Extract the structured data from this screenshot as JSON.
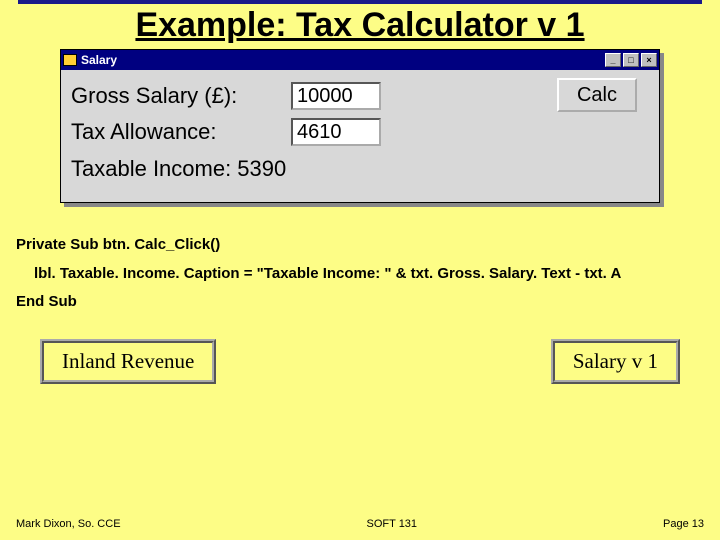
{
  "title": "Example: Tax Calculator v 1",
  "window": {
    "title": "Salary",
    "controls": {
      "min": "_",
      "max": "□",
      "close": "×"
    },
    "gross_label": "Gross Salary (£):",
    "gross_value": "10000",
    "allow_label": "Tax Allowance:",
    "allow_value": "4610",
    "result_label": "Taxable Income: 5390",
    "calc_label": "Calc"
  },
  "code": {
    "l1": "Private Sub btn. Calc_Click()",
    "l2": "lbl. Taxable. Income. Caption = \"Taxable Income: \" & txt. Gross. Salary. Text - txt. A",
    "l3": "End Sub"
  },
  "buttons": {
    "left": "Inland Revenue",
    "right": "Salary v 1"
  },
  "footer": {
    "left": "Mark Dixon, So. CCE",
    "mid": "SOFT 131",
    "right": "Page 13"
  }
}
